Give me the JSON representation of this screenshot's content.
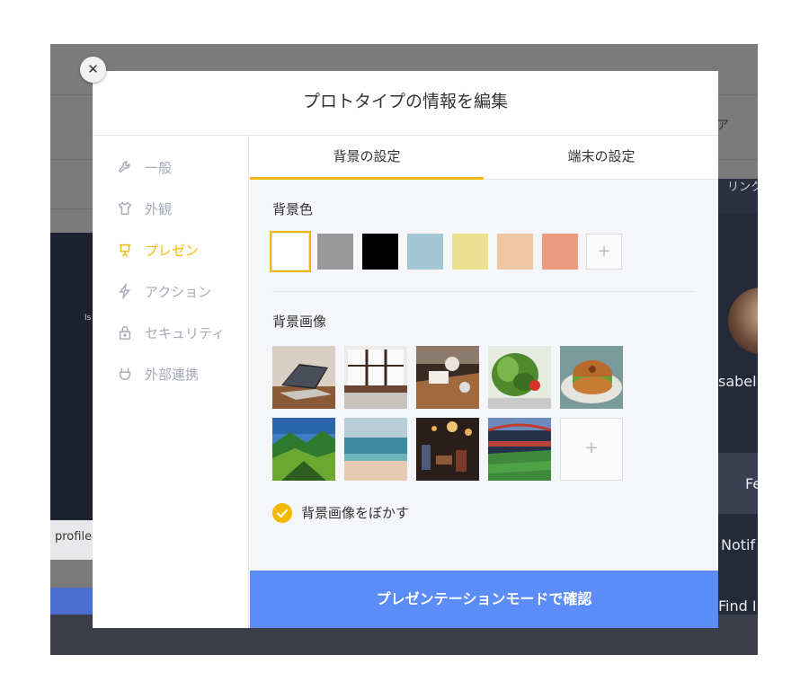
{
  "background_app": {
    "tab_right_partial": "ア",
    "link_label_partial": "リンク",
    "profile_tab": "profile-",
    "user_name_partial": "sabell",
    "item_fe": "Fe",
    "item_notif": "Notif",
    "item_find": "Find I",
    "label_is": "Is"
  },
  "modal": {
    "title": "プロトタイプの情報を編集",
    "close_glyph": "✕"
  },
  "sidebar": {
    "items": [
      {
        "label": "一般",
        "icon": "wrench-icon",
        "active": false
      },
      {
        "label": "外観",
        "icon": "shirt-icon",
        "active": false
      },
      {
        "label": "プレゼン",
        "icon": "projector-icon",
        "active": true
      },
      {
        "label": "アクション",
        "icon": "lightning-icon",
        "active": false
      },
      {
        "label": "セキュリティ",
        "icon": "lock-icon",
        "active": false
      },
      {
        "label": "外部連携",
        "icon": "plug-icon",
        "active": false
      }
    ]
  },
  "tabs": [
    {
      "label": "背景の設定",
      "active": true
    },
    {
      "label": "端末の設定",
      "active": false
    }
  ],
  "background_color": {
    "label": "背景色",
    "swatches": [
      "#ffffff",
      "#999999",
      "#000000",
      "#a3c7d6",
      "#eee090",
      "#eec7a2",
      "#ee9a80"
    ],
    "selected_index": 0,
    "add_glyph": "+"
  },
  "background_image": {
    "label": "背景画像",
    "images": [
      "laptop-photo",
      "window-desk-photo",
      "cafe-table-photo",
      "salad-photo",
      "bagel-photo",
      "mountain-valley-photo",
      "beach-photo",
      "restaurant-photo",
      "stadium-photo"
    ],
    "add_glyph": "+"
  },
  "blur_option": {
    "label": "背景画像をぼかす",
    "checked": true
  },
  "cta": {
    "label": "プレゼンテーションモードで確認"
  },
  "colors": {
    "accent": "#f5b800",
    "cta": "#5b8cf7",
    "muted": "#a5a9ba"
  }
}
